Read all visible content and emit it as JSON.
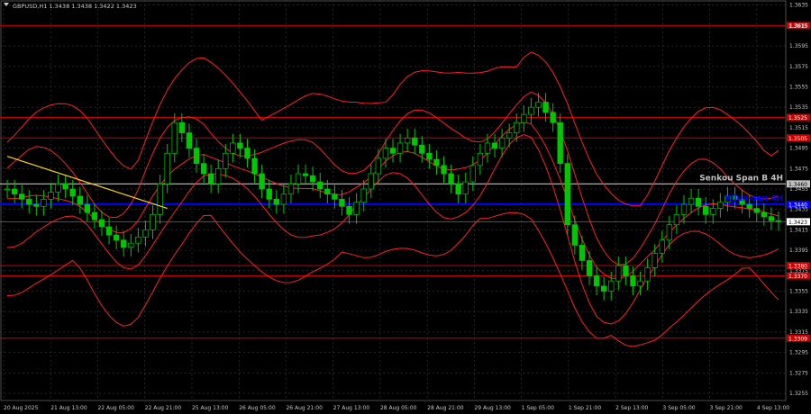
{
  "header": {
    "symbol_line": "GBPUSD,H1  1.3438 1.3438 1.3422 1.3423"
  },
  "colors": {
    "background": "#000000",
    "grid": "#3a3a3a",
    "candle": "#00c800",
    "band": "#ff2020",
    "level_red": "#c80000",
    "kijun": "#0000ff",
    "senkou": "#c0c0c0",
    "trendline": "#ffd700",
    "axis_text": "#c8c8c8"
  },
  "chart_data": {
    "type": "candlestick",
    "title": "GBPUSD,H1",
    "ylim": [
      1.3248,
      1.364
    ],
    "y_ticks": [
      "1.3635",
      "1.3615",
      "1.3595",
      "1.3575",
      "1.3555",
      "1.3535",
      "1.3515",
      "1.3495",
      "1.3475",
      "1.3455",
      "1.3435",
      "1.3415",
      "1.3395",
      "1.3375",
      "1.3355",
      "1.3335",
      "1.3315",
      "1.3295",
      "1.3275",
      "1.3255"
    ],
    "x_labels": [
      "20 Aug 2025",
      "21 Aug 13:00",
      "22 Aug 05:00",
      "22 Aug 21:00",
      "25 Aug 13:00",
      "26 Aug 05:00",
      "26 Aug 21:00",
      "27 Aug 13:00",
      "28 Aug 05:00",
      "28 Aug 21:00",
      "29 Aug 13:00",
      "1 Sep 05:00",
      "1 Sep 21:00",
      "2 Sep 13:00",
      "3 Sep 05:00",
      "3 Sep 21:00",
      "4 Sep 13:00"
    ],
    "support_resistance": [
      {
        "price": 1.3615,
        "label": "1.3615"
      },
      {
        "price": 1.3525,
        "label": "1.3525"
      },
      {
        "price": 1.3505,
        "label": "1.3505"
      },
      {
        "price": 1.338,
        "label": "1.3380"
      },
      {
        "price": 1.337,
        "label": "1.3370"
      },
      {
        "price": 1.3309,
        "label": "1.3309"
      }
    ],
    "indicators": [
      {
        "name": "Senkou Span B 4H",
        "price": 1.346,
        "label": "1.3460"
      },
      {
        "name": "Kijun-sen 4H",
        "price": 1.344,
        "label": "1.3440"
      }
    ],
    "current_price": {
      "price": 1.3423,
      "label": "1.3423"
    },
    "trendline": {
      "start": [
        0,
        1.3487
      ],
      "end": [
        22,
        1.3436
      ]
    },
    "candles_close": [
      1.3455,
      1.345,
      1.3445,
      1.344,
      1.3438,
      1.3445,
      1.3452,
      1.346,
      1.3455,
      1.3448,
      1.344,
      1.3432,
      1.3425,
      1.3418,
      1.341,
      1.3405,
      1.3398,
      1.3402,
      1.3408,
      1.3415,
      1.343,
      1.346,
      1.349,
      1.352,
      1.351,
      1.3495,
      1.348,
      1.347,
      1.346,
      1.3475,
      1.349,
      1.35,
      1.3495,
      1.3485,
      1.347,
      1.3455,
      1.3445,
      1.344,
      1.345,
      1.346,
      1.347,
      1.3468,
      1.3462,
      1.3455,
      1.345,
      1.3445,
      1.3438,
      1.343,
      1.3442,
      1.3455,
      1.347,
      1.3485,
      1.3495,
      1.349,
      1.35,
      1.3505,
      1.3498,
      1.349,
      1.3484,
      1.3478,
      1.347,
      1.346,
      1.345,
      1.3462,
      1.3478,
      1.349,
      1.35,
      1.3495,
      1.3505,
      1.351,
      1.352,
      1.3528,
      1.3535,
      1.354,
      1.353,
      1.352,
      1.348,
      1.342,
      1.34,
      1.3385,
      1.337,
      1.336,
      1.3355,
      1.3365,
      1.338,
      1.337,
      1.336,
      1.3365,
      1.3378,
      1.3392,
      1.3405,
      1.342,
      1.343,
      1.344,
      1.3446,
      1.3438,
      1.343,
      1.3436,
      1.3442,
      1.3448,
      1.3445,
      1.344,
      1.3436,
      1.3432,
      1.3428,
      1.3424,
      1.3423
    ]
  }
}
